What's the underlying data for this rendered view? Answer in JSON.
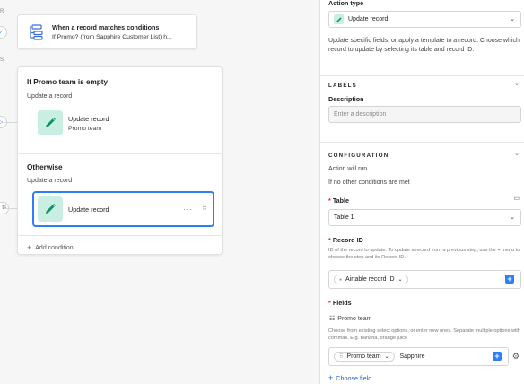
{
  "canvas": {
    "rail_labels": [
      "R",
      "S"
    ],
    "rail_pill_text": "ts",
    "trigger": {
      "title": "When a record matches conditions",
      "subtitle": "If Promo? (from Sapphire Customer List) h..."
    },
    "condition_group": {
      "branch1": {
        "heading": "If Promo team is empty",
        "sub": "Update a record",
        "action_title": "Update record",
        "action_sub": "Promo team"
      },
      "branch2": {
        "heading": "Otherwise",
        "sub": "Update a record",
        "action_title": "Update record",
        "menu_glyph": "···",
        "drag_glyph": "⠿"
      },
      "add_condition": "Add condition"
    }
  },
  "panel": {
    "action_type": {
      "label": "Action type",
      "value": "Update record",
      "description": "Update specific fields, or apply a template to a record. Choose which record to update by selecting its table and record ID."
    },
    "labels_section": {
      "title": "LABELS",
      "description_label": "Description",
      "description_placeholder": "Enter a description"
    },
    "configuration": {
      "title": "CONFIGURATION",
      "action_will_run": "Action will run...",
      "condition_text": "If no other conditions are met",
      "table": {
        "label": "Table",
        "value": "Table 1"
      },
      "record_id": {
        "label": "Record ID",
        "help": "ID of the record to update. To update a record from a previous step, use the + menu to choose the step and its Record ID.",
        "token": "Airtable record ID"
      },
      "fields": {
        "label": "Fields",
        "field_name": "Promo team",
        "help": "Choose from existing select options, or enter new ones. Separate multiple options with commas. E.g. banana, orange juice",
        "token": "Promo team",
        "suffix": ", Sapphire",
        "choose_field": "Choose field"
      }
    }
  },
  "colors": {
    "accent_blue": "#2d7ff9",
    "pencil_tile": "#c9efe3",
    "pencil_icon": "#0f8f6c",
    "required_red": "#d42b2b",
    "link_blue": "#1b66c9"
  }
}
